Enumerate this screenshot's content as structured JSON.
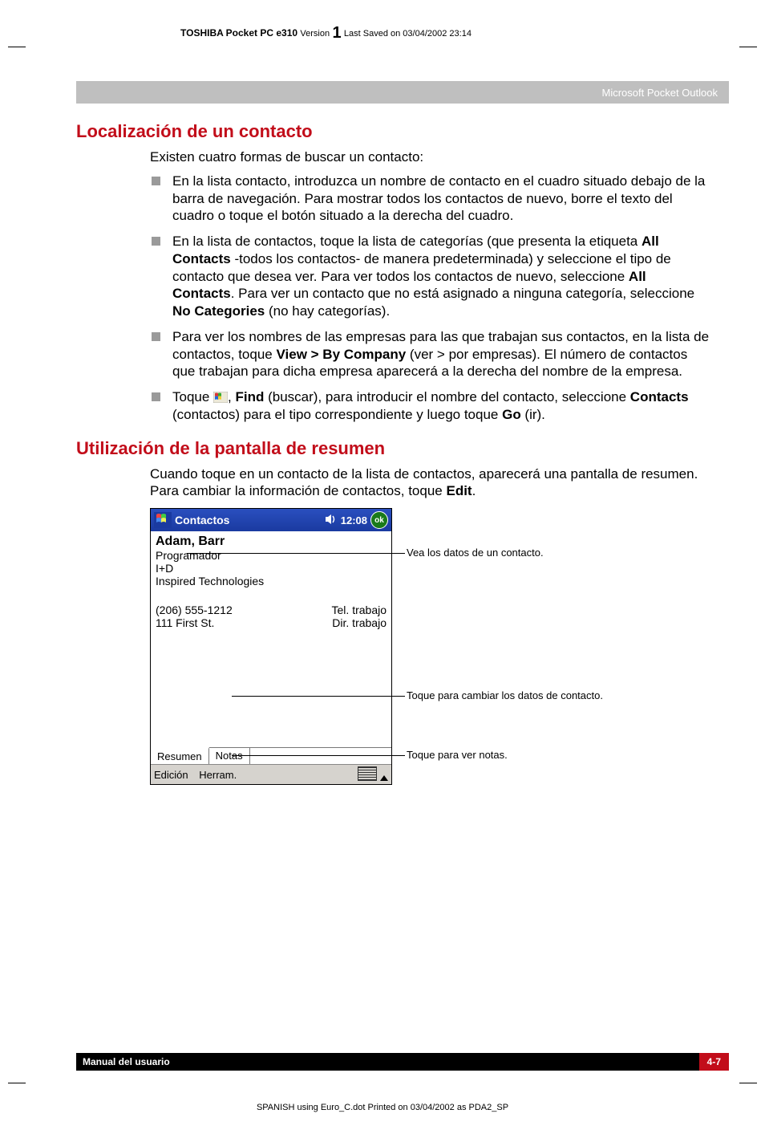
{
  "header": {
    "product": "TOSHIBA Pocket PC e310",
    "version_label": "Version",
    "version_num": "1",
    "saved": "Last Saved on 03/04/2002 23:14"
  },
  "band": "Microsoft Pocket Outlook",
  "section1": {
    "title": "Localización de un contacto",
    "intro": "Existen cuatro formas de buscar un contacto:",
    "bullets": {
      "b1": "En la lista contacto, introduzca un nombre de contacto en el cuadro situado debajo de la barra de navegación. Para mostrar todos los contactos de nuevo, borre el texto del cuadro o toque el botón situado a la derecha del cuadro.",
      "b2_pre": "En la lista de contactos, toque la lista de categorías (que presenta la etiqueta ",
      "b2_bold1": "All Contacts",
      "b2_mid1": " -todos los contactos- de manera predeterminada) y seleccione el tipo de contacto que desea ver. Para ver todos los contactos de nuevo, seleccione ",
      "b2_bold2": "All Contacts",
      "b2_mid2": ". Para ver un contacto que no está asignado a ninguna categoría, seleccione ",
      "b2_bold3": "No Categories",
      "b2_end": " (no hay categorías).",
      "b3_pre": "Para ver los nombres de las empresas para las que trabajan sus contactos, en la lista de contactos, toque ",
      "b3_bold": "View > By Company",
      "b3_end": " (ver > por empresas). El número de contactos que trabajan para dicha empresa aparecerá a la derecha del nombre de la empresa.",
      "b4_pre": "Toque ",
      "b4_mid1": ", ",
      "b4_bold1": "Find",
      "b4_mid2": " (buscar), para introducir el nombre del contacto, seleccione ",
      "b4_bold2": "Contacts",
      "b4_mid3": " (contactos) para el tipo correspondiente y luego toque ",
      "b4_bold3": "Go",
      "b4_end": " (ir)."
    }
  },
  "section2": {
    "title": "Utilización de la pantalla de resumen",
    "intro_pre": "Cuando toque en un contacto de la lista de contactos, aparecerá una pantalla de resumen. Para cambiar la información de contactos, toque ",
    "intro_bold": "Edit",
    "intro_end": "."
  },
  "shot": {
    "app": "Contactos",
    "time": "12:08",
    "ok": "ok",
    "name": "Adam, Barr",
    "role": "Programador",
    "dept": "I+D",
    "company": "Inspired Technologies",
    "phone": "(206) 555-1212",
    "phone_lbl": "Tel. trabajo",
    "addr": "111 First St.",
    "addr_lbl": "Dir. trabajo",
    "tab1": "Resumen",
    "tab2": "Notas",
    "menu1": "Edición",
    "menu2": "Herram."
  },
  "callouts": {
    "c1": "Vea los datos de un contacto.",
    "c2": "Toque para cambiar los datos de contacto.",
    "c3": "Toque para ver notas."
  },
  "footer": {
    "left": "Manual del usuario",
    "right": "4-7"
  },
  "printline": "SPANISH using Euro_C.dot  Printed on 03/04/2002 as PDA2_SP"
}
